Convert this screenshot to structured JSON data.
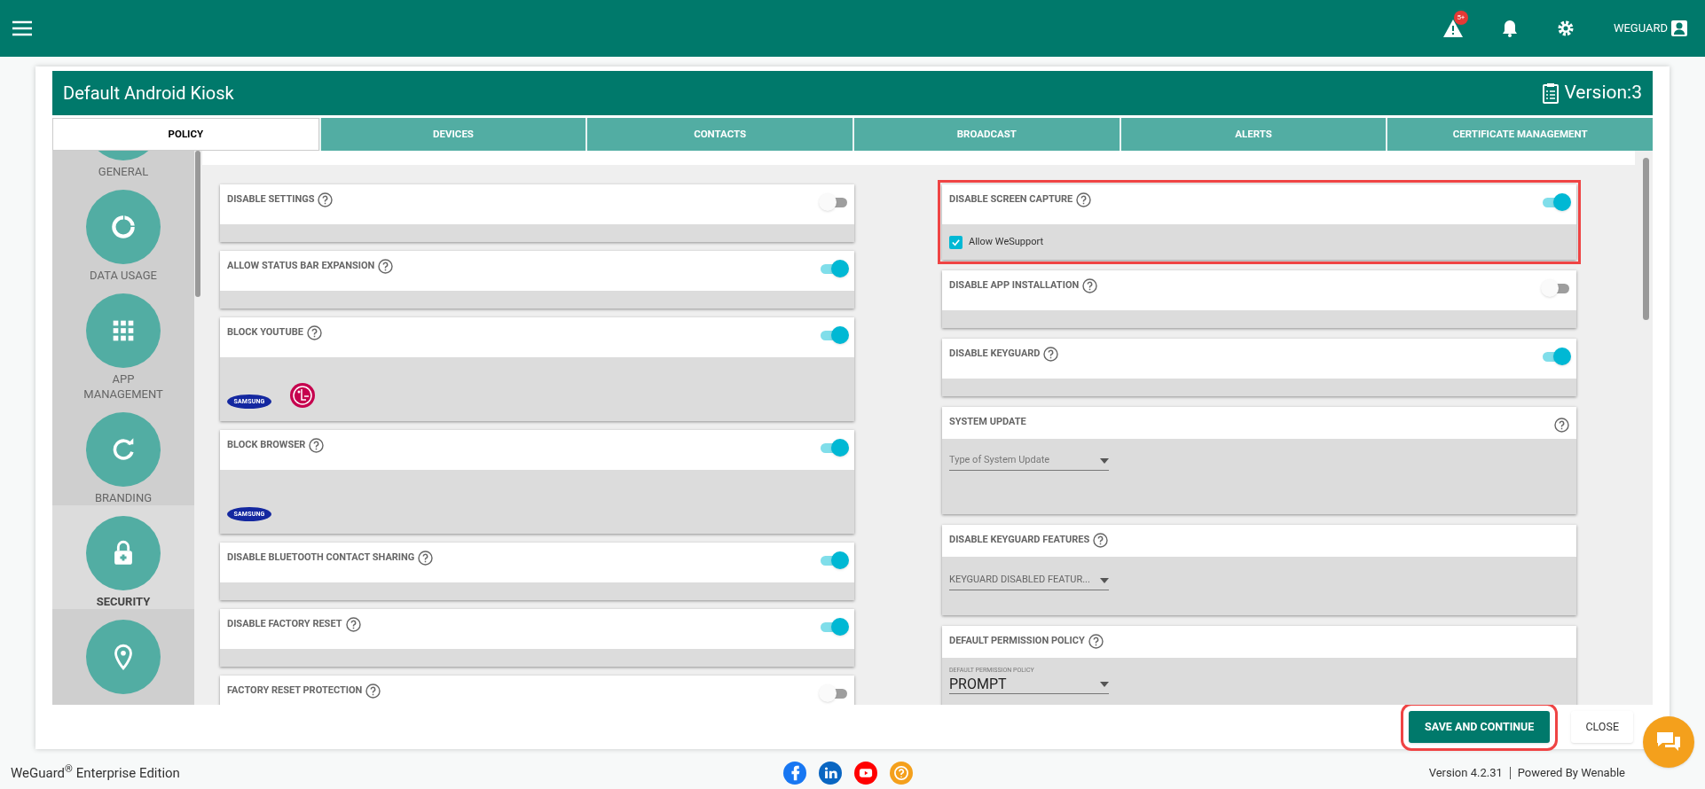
{
  "top_bar": {
    "alert_badge": "5+",
    "user": "WEGUARD"
  },
  "policy": {
    "title": "Default Android Kiosk",
    "version": "Version:3"
  },
  "tabs": [
    {
      "label": "POLICY",
      "selected": true
    },
    {
      "label": "DEVICES",
      "selected": false
    },
    {
      "label": "CONTACTS",
      "selected": false
    },
    {
      "label": "BROADCAST",
      "selected": false
    },
    {
      "label": "ALERTS",
      "selected": false
    },
    {
      "label": "CERTIFICATE MANAGEMENT",
      "selected": false
    }
  ],
  "sidebar": {
    "items": [
      {
        "kind": "general",
        "label": "GENERAL",
        "selected": false
      },
      {
        "kind": "data",
        "label": "DATA USAGE",
        "selected": false
      },
      {
        "kind": "apps",
        "label": "APP MANAGEMENT",
        "selected": false
      },
      {
        "kind": "branding",
        "label": "BRANDING",
        "selected": false
      },
      {
        "kind": "security",
        "label": "SECURITY",
        "selected": true
      },
      {
        "kind": "location",
        "selected": false
      }
    ]
  },
  "left_column": [
    {
      "title": "DISABLE SETTINGS",
      "on": false,
      "body": {
        "kind": "blank"
      }
    },
    {
      "title": "ALLOW STATUS BAR EXPANSION",
      "on": true,
      "body": {
        "kind": "blank"
      }
    },
    {
      "title": "BLOCK YOUTUBE",
      "on": true,
      "body": {
        "kind": "brands",
        "brands": [
          {
            "kind": "samsung",
            "text": "SAMSUNG"
          },
          {
            "kind": "lg"
          }
        ]
      }
    },
    {
      "title": "BLOCK BROWSER",
      "on": true,
      "body": {
        "kind": "brands",
        "brands": [
          {
            "kind": "samsung",
            "text": "SAMSUNG"
          }
        ]
      }
    },
    {
      "title": "DISABLE BLUETOOTH CONTACT SHARING",
      "on": true,
      "body": {
        "kind": "blank"
      }
    },
    {
      "title": "DISABLE FACTORY RESET",
      "on": true,
      "body": {
        "kind": "blank"
      }
    },
    {
      "title": "FACTORY RESET PROTECTION",
      "on": false,
      "body": {
        "kind": "blank"
      }
    }
  ],
  "right_column": [
    {
      "title": "DISABLE SCREEN CAPTURE",
      "on": true,
      "highlighted": true,
      "body": {
        "kind": "checkbox",
        "label": "Allow WeSupport",
        "checked": true
      }
    },
    {
      "title": "DISABLE APP INSTALLATION",
      "on": false,
      "body": {
        "kind": "blank"
      }
    },
    {
      "title": "DISABLE KEYGUARD",
      "on": true,
      "body": {
        "kind": "blank"
      }
    },
    {
      "title": "SYSTEM UPDATE",
      "help_right": true,
      "body": {
        "kind": "select",
        "placeholder": "Type of System Update"
      }
    },
    {
      "title": "DISABLE KEYGUARD FEATURES",
      "body": {
        "kind": "select",
        "value": "KEYGUARD DISABLED FEATUR..."
      }
    },
    {
      "title": "DEFAULT PERMISSION POLICY",
      "body": {
        "kind": "select",
        "floating_label": "DEFAULT PERMISSION POLICY",
        "value": "PROMPT"
      }
    }
  ],
  "buttons": [
    {
      "label": "SAVE AND CONTINUE",
      "kind": "primary",
      "highlighted": true
    },
    {
      "label": "CLOSE",
      "kind": "plain",
      "highlighted": false
    }
  ],
  "footer": {
    "edition": "WeGuard$^{®}$ Enterprise Edition",
    "social": [
      {
        "kind": "facebook",
        "color": "#1877f2"
      },
      {
        "kind": "linkedin",
        "color": "#0a66c2"
      },
      {
        "kind": "youtube",
        "color": "#ff0000"
      },
      {
        "kind": "help",
        "color": "#f4a01c"
      }
    ],
    "version": "Version 4.2.31",
    "powered": "Powered By Wenable"
  }
}
